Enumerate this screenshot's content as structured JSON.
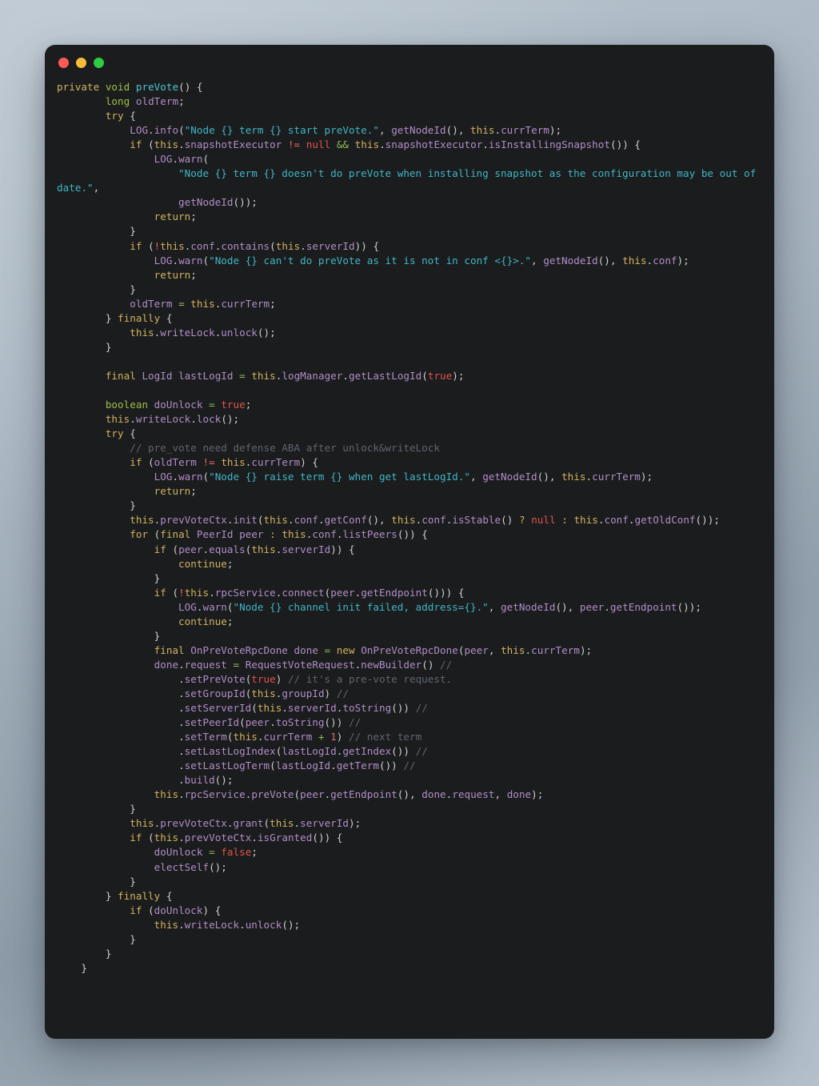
{
  "window": {
    "title_bar": {
      "buttons": [
        {
          "name": "close-button",
          "color": "#fc5b57",
          "label": ""
        },
        {
          "name": "minimize-button",
          "color": "#f6bd3b",
          "label": ""
        },
        {
          "name": "maximize-button",
          "color": "#2ecc40",
          "label": ""
        }
      ]
    },
    "background_color": "#1b1c1d",
    "desktop_color": "#a6b3bf"
  },
  "theme": {
    "keyword": "#d2b261",
    "type": "#9fbf4a",
    "class": "#b08ec9",
    "function": "#4ec3d4",
    "string": "#3fb6c6",
    "literal": "#e0544a",
    "operator": "#8fbc5a",
    "punctuation": "#cfcfcf",
    "variable": "#b08ec9",
    "comment": "#5c6670",
    "foreground": "#d8d8d8"
  },
  "code": {
    "language": "java",
    "method_name": "preVote",
    "lines": [
      "private void preVote() {",
      "        long oldTerm;",
      "        try {",
      "            LOG.info(\"Node {} term {} start preVote.\", getNodeId(), this.currTerm);",
      "            if (this.snapshotExecutor != null && this.snapshotExecutor.isInstallingSnapshot()) {",
      "                LOG.warn(",
      "                    \"Node {} term {} doesn't do preVote when installing snapshot as the configuration may be out of date.\",",
      "                    getNodeId());",
      "                return;",
      "            }",
      "            if (!this.conf.contains(this.serverId)) {",
      "                LOG.warn(\"Node {} can't do preVote as it is not in conf <{}>.\", getNodeId(), this.conf);",
      "                return;",
      "            }",
      "            oldTerm = this.currTerm;",
      "        } finally {",
      "            this.writeLock.unlock();",
      "        }",
      "",
      "        final LogId lastLogId = this.logManager.getLastLogId(true);",
      "",
      "        boolean doUnlock = true;",
      "        this.writeLock.lock();",
      "        try {",
      "            // pre_vote need defense ABA after unlock&writeLock",
      "            if (oldTerm != this.currTerm) {",
      "                LOG.warn(\"Node {} raise term {} when get lastLogId.\", getNodeId(), this.currTerm);",
      "                return;",
      "            }",
      "            this.prevVoteCtx.init(this.conf.getConf(), this.conf.isStable() ? null : this.conf.getOldConf());",
      "            for (final PeerId peer : this.conf.listPeers()) {",
      "                if (peer.equals(this.serverId)) {",
      "                    continue;",
      "                }",
      "                if (!this.rpcService.connect(peer.getEndpoint())) {",
      "                    LOG.warn(\"Node {} channel init failed, address={}.\", getNodeId(), peer.getEndpoint());",
      "                    continue;",
      "                }",
      "                final OnPreVoteRpcDone done = new OnPreVoteRpcDone(peer, this.currTerm);",
      "                done.request = RequestVoteRequest.newBuilder() //",
      "                    .setPreVote(true) // it's a pre-vote request.",
      "                    .setGroupId(this.groupId) //",
      "                    .setServerId(this.serverId.toString()) //",
      "                    .setPeerId(peer.toString()) //",
      "                    .setTerm(this.currTerm + 1) // next term",
      "                    .setLastLogIndex(lastLogId.getIndex()) //",
      "                    .setLastLogTerm(lastLogId.getTerm()) //",
      "                    .build();",
      "                this.rpcService.preVote(peer.getEndpoint(), done.request, done);",
      "            }",
      "            this.prevVoteCtx.grant(this.serverId);",
      "            if (this.prevVoteCtx.isGranted()) {",
      "                doUnlock = false;",
      "                electSelf();",
      "            }",
      "        } finally {",
      "            if (doUnlock) {",
      "                this.writeLock.unlock();",
      "            }",
      "        }",
      "    }"
    ]
  }
}
